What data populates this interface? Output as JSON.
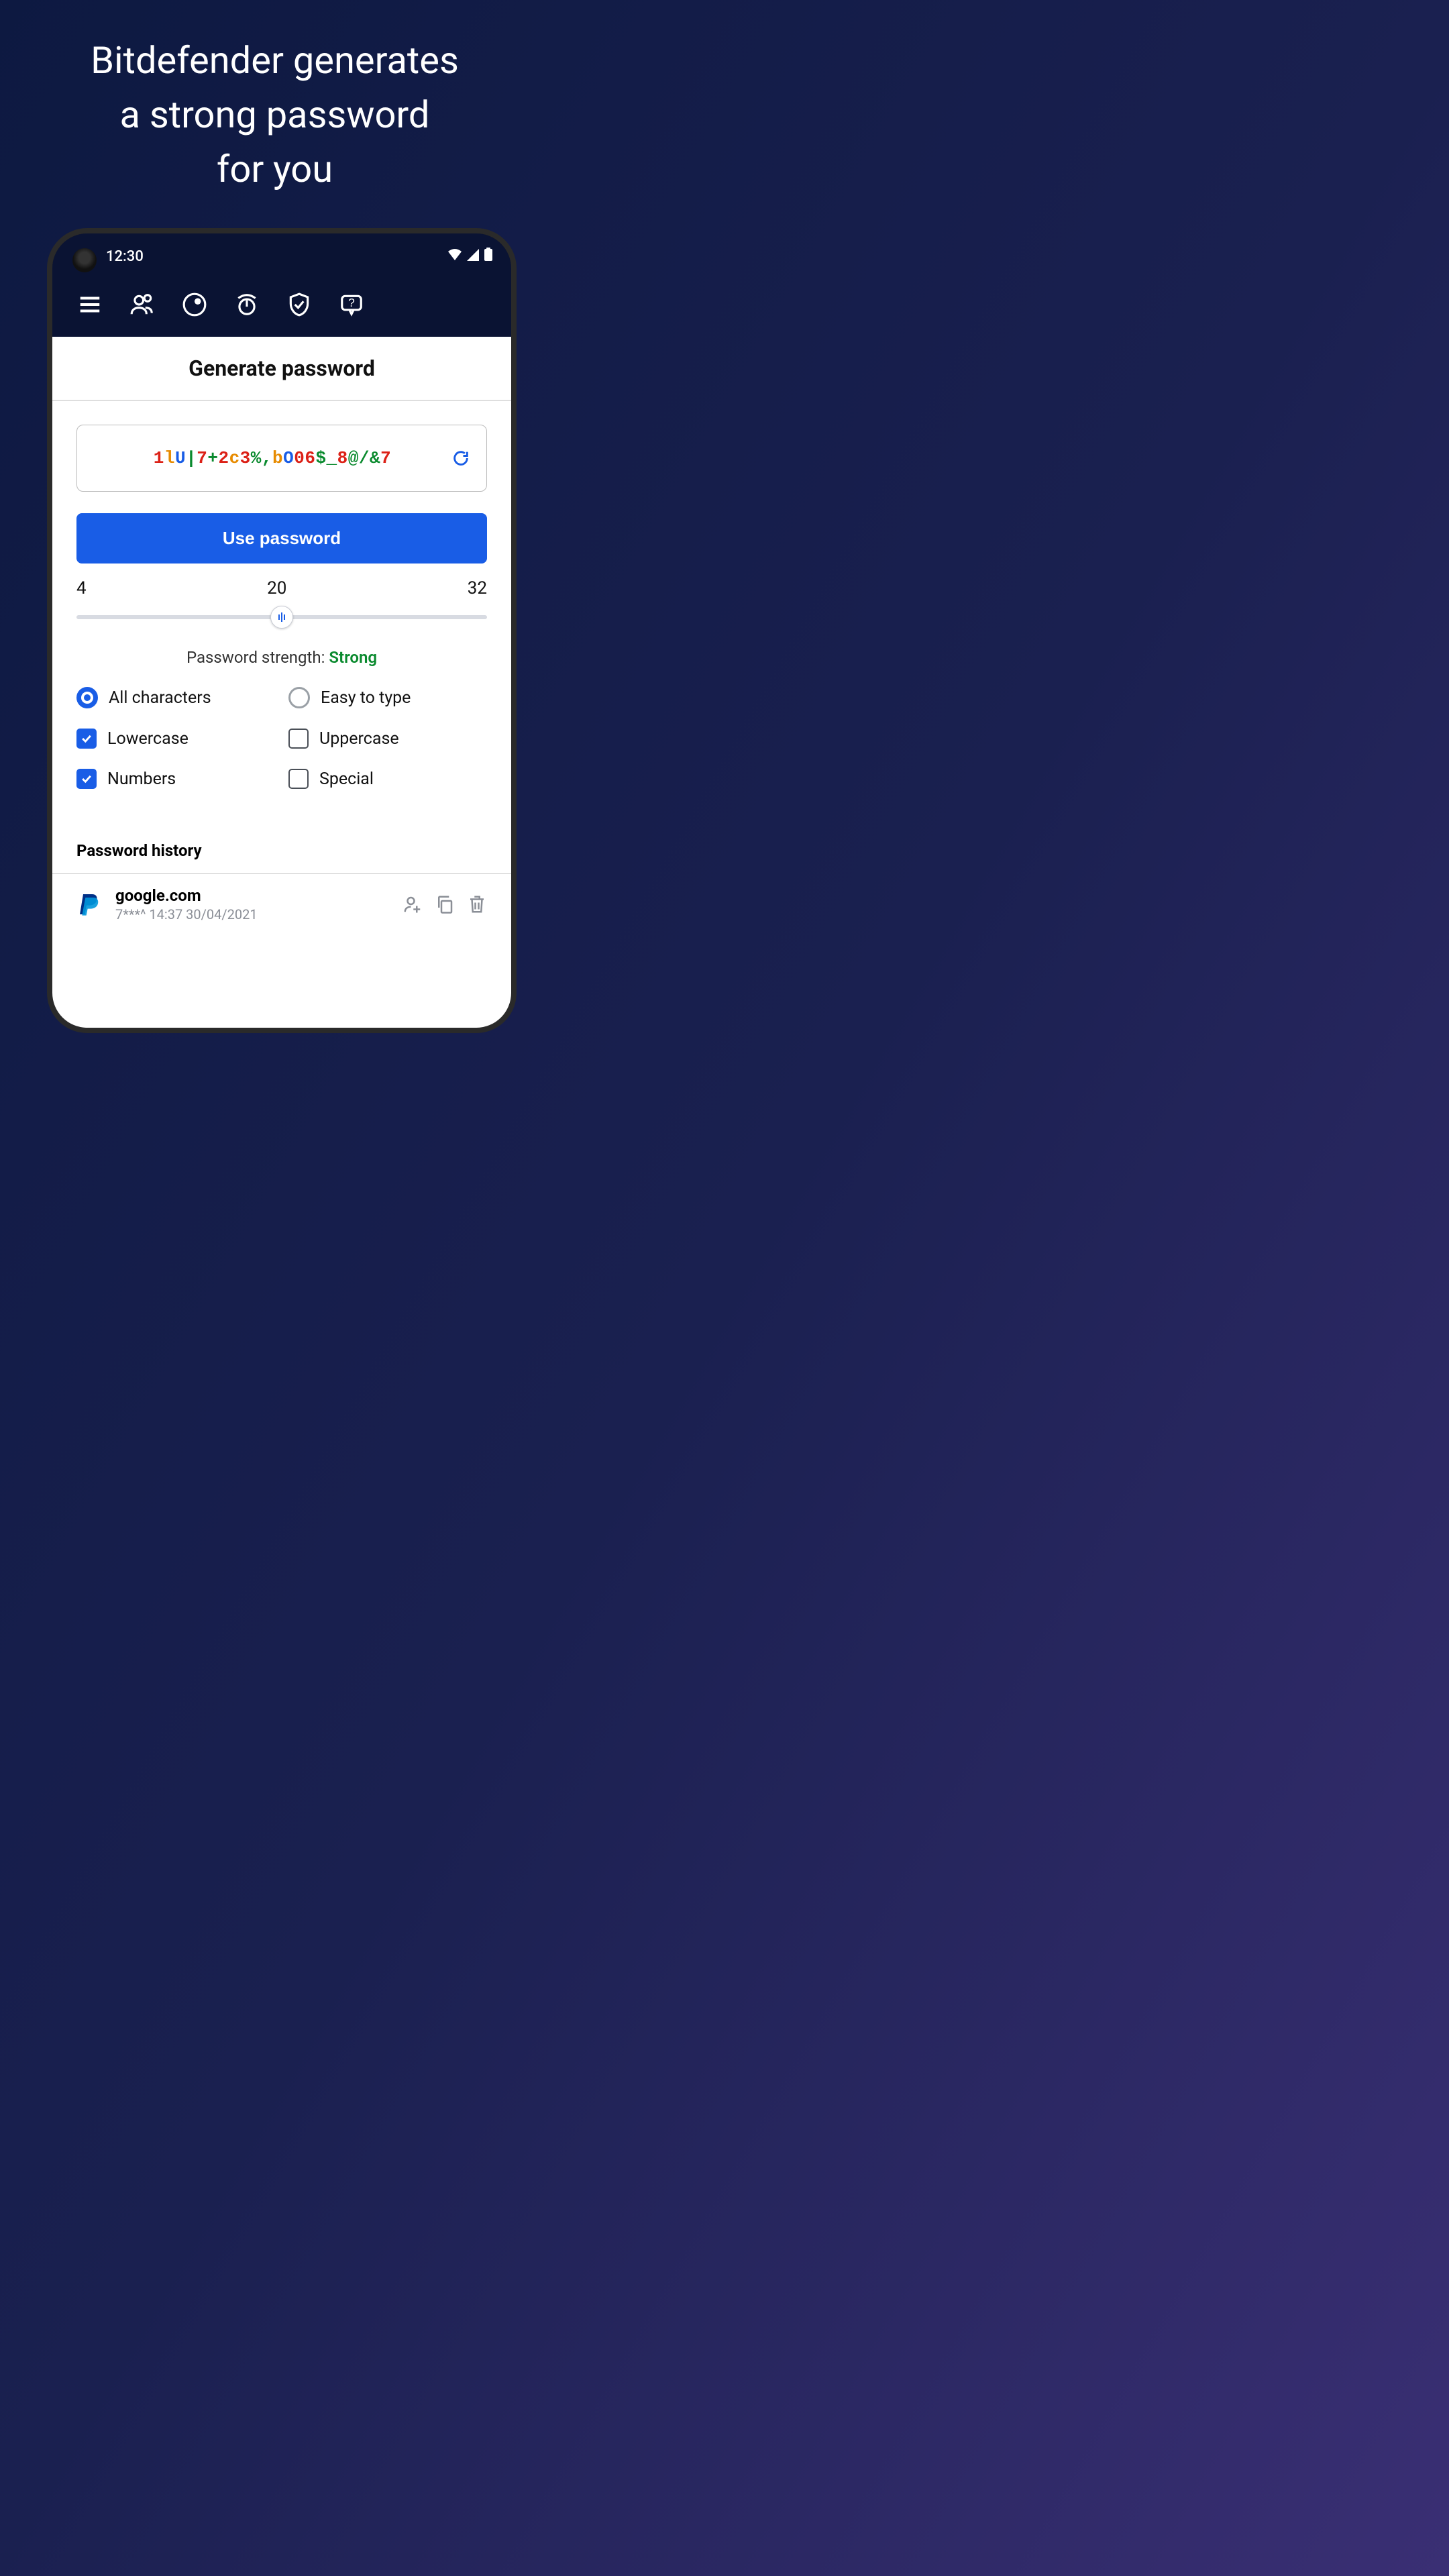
{
  "promo": {
    "headline_line1": "Bitdefender generates",
    "headline_line2": "a strong password",
    "headline_line3": "for you"
  },
  "status": {
    "time": "12:30"
  },
  "screen": {
    "title": "Generate password",
    "password_chars": [
      {
        "c": "1",
        "k": "r"
      },
      {
        "c": "l",
        "k": "o"
      },
      {
        "c": "U",
        "k": "b"
      },
      {
        "c": "|",
        "k": "g"
      },
      {
        "c": "7",
        "k": "r"
      },
      {
        "c": "+",
        "k": "g"
      },
      {
        "c": "2",
        "k": "r"
      },
      {
        "c": "c",
        "k": "o"
      },
      {
        "c": "3",
        "k": "r"
      },
      {
        "c": "%",
        "k": "g"
      },
      {
        "c": ",",
        "k": "g"
      },
      {
        "c": "b",
        "k": "o"
      },
      {
        "c": "O",
        "k": "b"
      },
      {
        "c": "0",
        "k": "r"
      },
      {
        "c": "6",
        "k": "r"
      },
      {
        "c": "$",
        "k": "g"
      },
      {
        "c": "_",
        "k": "g"
      },
      {
        "c": "8",
        "k": "r"
      },
      {
        "c": "@",
        "k": "g"
      },
      {
        "c": "/",
        "k": "g"
      },
      {
        "c": "&",
        "k": "g"
      },
      {
        "c": "7",
        "k": "r"
      }
    ],
    "use_btn": "Use password",
    "length": {
      "min": "4",
      "mid": "20",
      "max": "32",
      "value": 20
    },
    "strength_label": "Password strength: ",
    "strength_value": "Strong",
    "options": {
      "all_chars": {
        "label": "All characters",
        "selected": true,
        "type": "radio"
      },
      "easy_type": {
        "label": "Easy to type",
        "selected": false,
        "type": "radio"
      },
      "lowercase": {
        "label": "Lowercase",
        "selected": true,
        "type": "check"
      },
      "uppercase": {
        "label": "Uppercase",
        "selected": false,
        "type": "check"
      },
      "numbers": {
        "label": "Numbers",
        "selected": true,
        "type": "check"
      },
      "special": {
        "label": "Special",
        "selected": false,
        "type": "check"
      }
    },
    "history_title": "Password history",
    "history": [
      {
        "site": "google.com",
        "meta": "7***^  14:37 30/04/2021"
      }
    ]
  }
}
